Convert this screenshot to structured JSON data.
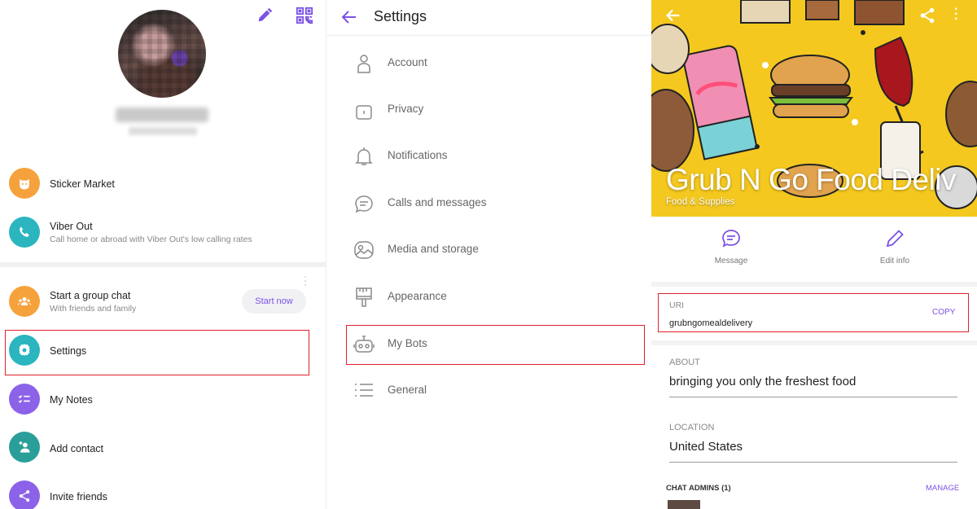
{
  "left_panel": {
    "menu": {
      "sticker_market": "Sticker Market",
      "viber_out": "Viber Out",
      "viber_out_sub": "Call home or abroad with Viber Out's low calling rates",
      "group_chat": "Start a group chat",
      "group_chat_sub": "With friends and family",
      "start_now": "Start now",
      "settings": "Settings",
      "my_notes": "My Notes",
      "add_contact": "Add contact",
      "invite_friends": "Invite friends"
    },
    "icons": {
      "edit": "pencil-icon",
      "qr": "qr-code-icon"
    },
    "colors": {
      "sticker": "#f6a23c",
      "viber_out": "#2ab5bf",
      "group": "#f6a23c",
      "settings": "#2ab5bf",
      "notes": "#8b62e8",
      "add_contact": "#2a9e98",
      "invite": "#8b62e8"
    }
  },
  "middle_panel": {
    "title": "Settings",
    "items": [
      {
        "label": "Account",
        "icon": "person-icon"
      },
      {
        "label": "Privacy",
        "icon": "lock-icon"
      },
      {
        "label": "Notifications",
        "icon": "bell-icon"
      },
      {
        "label": "Calls and messages",
        "icon": "chat-bubble-icon"
      },
      {
        "label": "Media and storage",
        "icon": "image-icon"
      },
      {
        "label": "Appearance",
        "icon": "paintbrush-icon"
      },
      {
        "label": "My Bots",
        "icon": "robot-icon"
      },
      {
        "label": "General",
        "icon": "list-icon"
      }
    ]
  },
  "right_panel": {
    "cover_title": "Grub N Go Food Deliv",
    "cover_subtitle": "Food & Supplies",
    "actions": {
      "message": "Message",
      "edit_info": "Edit info"
    },
    "uri": {
      "label": "URI",
      "value": "grubngomealdelivery",
      "copy": "COPY"
    },
    "about": {
      "label": "ABOUT",
      "value": "bringing you only the freshest food"
    },
    "location": {
      "label": "LOCATION",
      "value": "United States"
    },
    "admins": {
      "label": "CHAT ADMINS (1)",
      "manage": "MANAGE"
    },
    "colors": {
      "accent": "#7c52e6",
      "cover_bg": "#f4c81f"
    }
  }
}
